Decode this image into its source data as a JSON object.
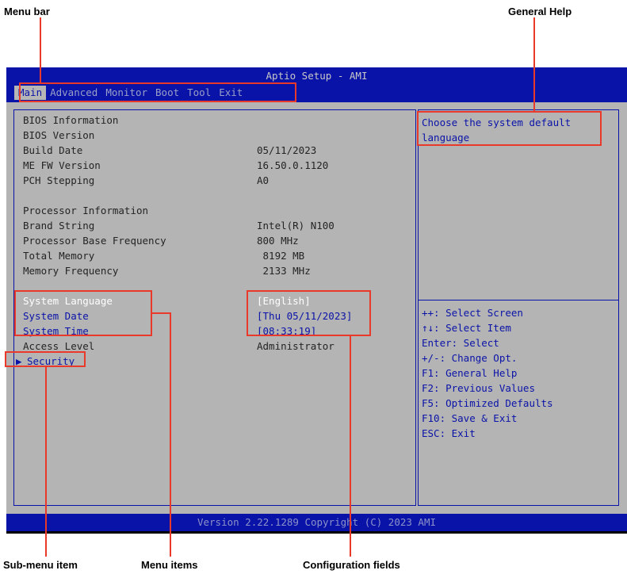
{
  "callouts": {
    "menu_bar": "Menu bar",
    "general_help": "General Help",
    "submenu_item": "Sub-menu item",
    "menu_items": "Menu items",
    "config_fields": "Configuration fields"
  },
  "window": {
    "title": "Aptio Setup - AMI"
  },
  "menubar": {
    "tabs": [
      {
        "label": "Main",
        "active": true
      },
      {
        "label": "Advanced"
      },
      {
        "label": "Monitor"
      },
      {
        "label": "Boot"
      },
      {
        "label": "Tool"
      },
      {
        "label": "Exit"
      }
    ]
  },
  "main": {
    "bios_info_heading": "BIOS Information",
    "bios_version_label": "BIOS Version",
    "build_date_label": "Build Date",
    "build_date_value": "05/11/2023",
    "me_fw_label": "ME FW Version",
    "me_fw_value": "16.50.0.1120",
    "pch_stepping_label": "PCH Stepping",
    "pch_stepping_value": "A0",
    "processor_heading": "Processor Information",
    "brand_label": "Brand String",
    "brand_value": "Intel(R) N100",
    "base_freq_label": "Processor Base Frequency",
    "base_freq_value": "800 MHz",
    "total_memory_label": "Total Memory",
    "total_memory_value": " 8192 MB",
    "mem_freq_label": "Memory Frequency",
    "mem_freq_value": " 2133 MHz",
    "system_language_label": "System Language",
    "system_language_value": "[English]",
    "system_date_label": "System Date",
    "system_date_value": "[Thu 05/11/2023]",
    "system_time_label": "System Time",
    "system_time_value": "[08:33:19]",
    "access_level_label": "Access Level",
    "access_level_value": "Administrator",
    "security_label": "Security"
  },
  "help": {
    "text": "Choose the system default language",
    "keys": [
      "++: Select Screen",
      "↑↓: Select Item",
      "Enter: Select",
      "+/-: Change Opt.",
      "F1: General Help",
      "F2: Previous Values",
      "F5: Optimized Defaults",
      "F10: Save & Exit",
      "ESC: Exit"
    ]
  },
  "footer": {
    "text": "Version 2.22.1289 Copyright (C) 2023 AMI"
  },
  "colors": {
    "bios_blue": "#0a13a8",
    "panel_gray": "#b4b4b4",
    "callout_red": "#e8392b"
  }
}
